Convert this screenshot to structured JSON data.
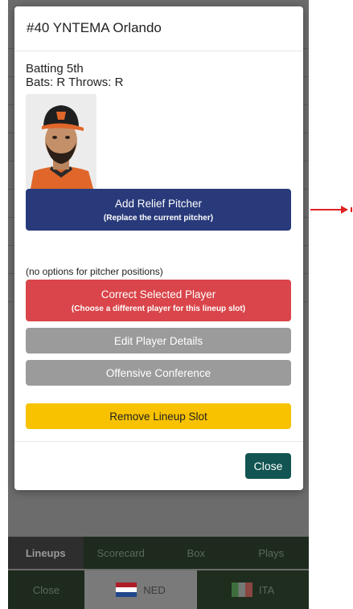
{
  "modal": {
    "title": "#40 YNTEMA Orlando",
    "batting_order": "Batting 5th",
    "bats_throws": "Bats: R Throws: R",
    "buttons": {
      "relief": {
        "label": "Add Relief Pitcher",
        "sub": "(Replace the current pitcher)"
      },
      "no_options_note": "(no options for pitcher positions)",
      "correct": {
        "label": "Correct Selected Player",
        "sub": "(Choose a different player for this lineup slot)"
      },
      "edit": "Edit Player Details",
      "offensive": "Offensive Conference",
      "remove": "Remove Lineup Slot",
      "close": "Close"
    }
  },
  "bottom_tabs": [
    "Lineups",
    "Scorecard",
    "Box",
    "Plays"
  ],
  "bottom_bar": {
    "close": "Close",
    "home_team": "NED",
    "away_team": "ITA"
  },
  "colors": {
    "relief": "#283a7a",
    "correct": "#d9454a",
    "secondary": "#9b9b9b",
    "remove": "#f8c200",
    "close": "#125452",
    "annotation": "#e02020"
  }
}
